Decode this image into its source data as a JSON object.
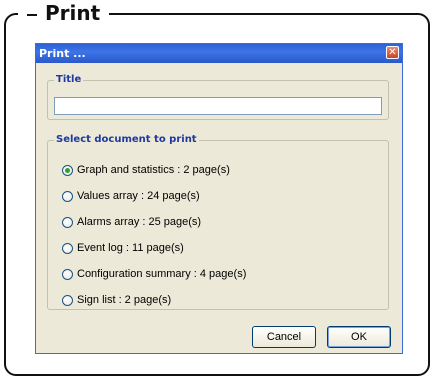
{
  "frame": {
    "title": "Print"
  },
  "window": {
    "title": "Print ...",
    "close_glyph": "✕"
  },
  "title_group": {
    "label": "Title",
    "value": ""
  },
  "documents_group": {
    "label": "Select document to print",
    "options": [
      {
        "label": "Graph and statistics : 2 page(s)",
        "selected": true
      },
      {
        "label": "Values array : 24 page(s)",
        "selected": false
      },
      {
        "label": "Alarms array : 25 page(s)",
        "selected": false
      },
      {
        "label": "Event log : 11 page(s)",
        "selected": false
      },
      {
        "label": "Configuration summary : 4 page(s)",
        "selected": false
      },
      {
        "label": "Sign list : 2 page(s)",
        "selected": false
      }
    ]
  },
  "buttons": {
    "cancel": "Cancel",
    "ok": "OK"
  },
  "colors": {
    "titlebar": "#2e61d6",
    "group_label": "#1c3aa0",
    "window_bg": "#ece9d8"
  }
}
